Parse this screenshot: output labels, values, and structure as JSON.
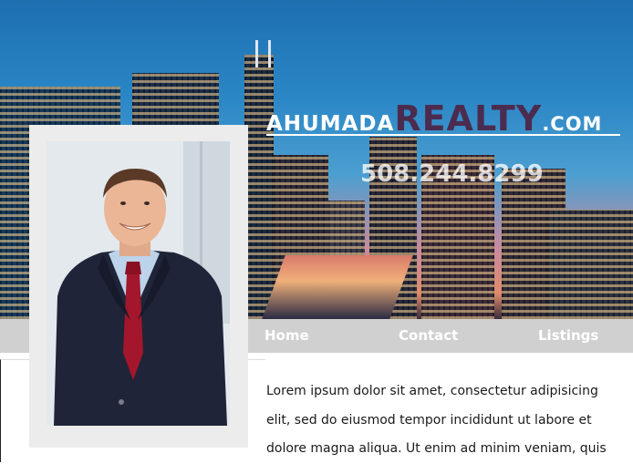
{
  "brand": {
    "part1": "AHUMADA",
    "part2": "REALTY",
    "part3": ".COM",
    "accent": "#4b2c4f"
  },
  "phone": "508.244.8299",
  "nav": {
    "items": [
      {
        "label": "Home"
      },
      {
        "label": "Contact"
      },
      {
        "label": "Listings"
      }
    ],
    "background": "#d0d0d0"
  },
  "content": {
    "text": "Lorem ipsum dolor sit amet, consectetur adipisicing elit, sed do eiusmod tempor incididunt ut labore et dolore magna aliqua. Ut enim ad minim veniam, quis"
  },
  "photo": {
    "subject": "agent-portrait"
  }
}
